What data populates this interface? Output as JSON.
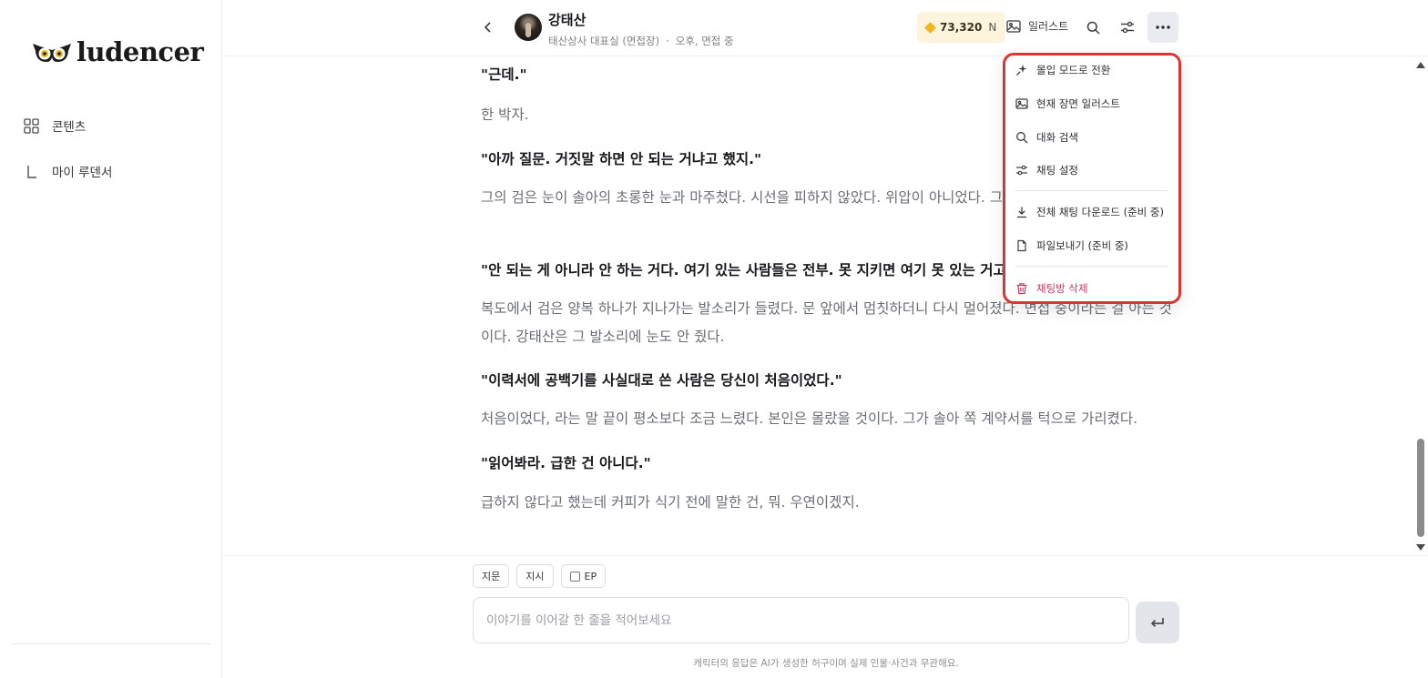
{
  "sidebar": {
    "logo_text": "ludencer",
    "items": [
      {
        "label": "콘텐츠",
        "icon": "grid-icon"
      },
      {
        "label": "마이 루덴서",
        "icon": "corner-icon"
      }
    ]
  },
  "header": {
    "character_name": "강태산",
    "location": "태산상사 대표실 (면접장)",
    "separator": "·",
    "status": "오후, 면접 중",
    "coins_value": "73,320",
    "coins_unit": "N",
    "illust_label": "일러스트"
  },
  "messages": [
    {
      "type": "dialogue",
      "text": "\"근데.\""
    },
    {
      "type": "narration",
      "text": "한 박자."
    },
    {
      "type": "dialogue",
      "text": "\"아까 질문. 거짓말 하면 안 되는 거냐고 했지.\""
    },
    {
      "type": "narration",
      "text": "그의 검은 눈이 솔아의 초롱한 눈과 마주쳤다. 시선을 피하지 않았다. 위압이 아니었다. 그냥 보는 것이었다."
    },
    {
      "type": "dialogue",
      "text": "\"안 되는 게 아니라 안 하는 거다. 여기 있는 사람들은 전부. 못 지키면 여기 못 있는 거고.\""
    },
    {
      "type": "narration",
      "text": "복도에서 검은 양복 하나가 지나가는 발소리가 들렸다. 문 앞에서 멈칫하더니 다시 멀어졌다. 면접 중이라는 걸 아는 것이다. 강태산은 그 발소리에 눈도 안 줬다."
    },
    {
      "type": "dialogue",
      "text": "\"이력서에 공백기를 사실대로 쓴 사람은 당신이 처음이었다.\""
    },
    {
      "type": "narration",
      "text": "처음이었다, 라는 말 끝이 평소보다 조금 느렸다. 본인은 몰랐을 것이다. 그가 솔아 쪽 계약서를 턱으로 가리켰다."
    },
    {
      "type": "dialogue",
      "text": "\"읽어봐라. 급한 건 아니다.\""
    },
    {
      "type": "narration",
      "text": "급하지 않다고 했는데 커피가 식기 전에 말한 건, 뭐. 우연이겠지."
    }
  ],
  "menu": {
    "items": [
      {
        "label": "몰입 모드로 전환",
        "icon": "sparkle-icon"
      },
      {
        "label": "현재 장면 일러스트",
        "icon": "image-icon"
      },
      {
        "label": "대화 검색",
        "icon": "search-icon"
      },
      {
        "label": "채팅 설정",
        "icon": "sliders-icon"
      },
      {
        "label": "전체 채팅 다운로드 (준비 중)",
        "icon": "download-icon"
      },
      {
        "label": "파일보내기 (준비 중)",
        "icon": "file-icon"
      },
      {
        "label": "채팅방 삭제",
        "icon": "trash-icon"
      }
    ]
  },
  "composer": {
    "chip_narration": "지문",
    "chip_instruction": "지시",
    "chip_ep": "EP",
    "placeholder": "이야기를 이어갈 한 줄을 적어보세요",
    "disclaimer": "캐릭터의 응답은 AI가 생성한 허구이며 실제 인물·사건과 무관해요."
  },
  "colors": {
    "menu_border": "#d8372f",
    "danger": "#c43a62",
    "coin": "#f2b51c"
  }
}
